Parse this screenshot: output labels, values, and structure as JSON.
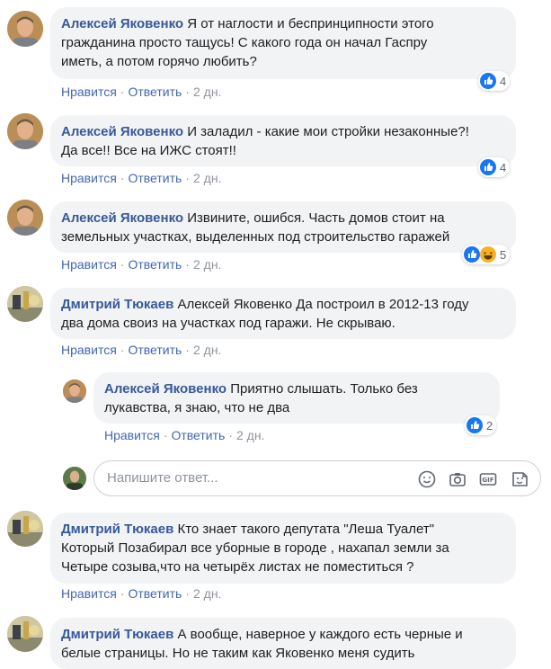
{
  "colors": {
    "author": "#385898",
    "link": "#4267b2",
    "meta": "#90949c",
    "bubble": "#f2f3f5",
    "like": "#1877f2",
    "haha": "#f7b125"
  },
  "comments": [
    {
      "author": "Алексей Яковенко",
      "text_lines": [
        "Я от наглости и беспринципности этого",
        "гражданина просто тащусь! С какого года он начал Гаспру",
        "иметь, а потом горячо любить?"
      ],
      "like": "Нравится",
      "reply": "Ответить",
      "time": "2 дн.",
      "reaction_count": "4",
      "reactions": [
        "like-icon"
      ]
    },
    {
      "author": "Алексей Яковенко",
      "text_lines": [
        "И заладил - какие мои стройки незаконные?!",
        "Да все!! Все на ИЖС стоят!!"
      ],
      "like": "Нравится",
      "reply": "Ответить",
      "time": "2 дн.",
      "reaction_count": "4",
      "reactions": [
        "like-icon"
      ]
    },
    {
      "author": "Алексей Яковенко",
      "text_lines": [
        "Извините, ошибся. Часть домов стоит на",
        "земельных участках, выделенных под строительство гаражей"
      ],
      "like": "Нравится",
      "reply": "Ответить",
      "time": "2 дн.",
      "reaction_count": "5",
      "reactions": [
        "like-icon",
        "haha-icon"
      ]
    },
    {
      "author": "Дмитрий Тюкаев",
      "text_lines": [
        "Алексей Яковенко Да построил в 2012-13 году",
        "два дома своиз на участках под гаражи. Не скрываю."
      ],
      "like": "Нравится",
      "reply": "Ответить",
      "time": "2 дн."
    },
    {
      "author": "Алексей Яковенко",
      "text_lines": [
        "Приятно слышать. Только без",
        "лукавства, я знаю, что не два"
      ],
      "like": "Нравится",
      "reply": "Ответить",
      "time": "2 дн.",
      "reaction_count": "2",
      "reactions": [
        "like-icon"
      ]
    },
    {
      "author": "Дмитрий Тюкаев",
      "text_lines": [
        "Кто знает такого депутата \"Леша Туалет\"",
        "Который Позабирал все уборные в городе , нахапал земли за",
        "Четыре созыва,что на четырёх листах не поместиться ?"
      ],
      "like": "Нравится",
      "reply": "Ответить",
      "time": "2 дн."
    },
    {
      "author": "Дмитрий Тюкаев",
      "text_lines": [
        "А вообще, наверное у каждого есть черные и",
        "белые страницы. Но не таким как Яковенко меня судить"
      ]
    }
  ],
  "reply_box": {
    "placeholder": "Напишите ответ...",
    "tools": [
      "emoji-icon",
      "camera-icon",
      "gif-icon",
      "sticker-icon"
    ]
  }
}
